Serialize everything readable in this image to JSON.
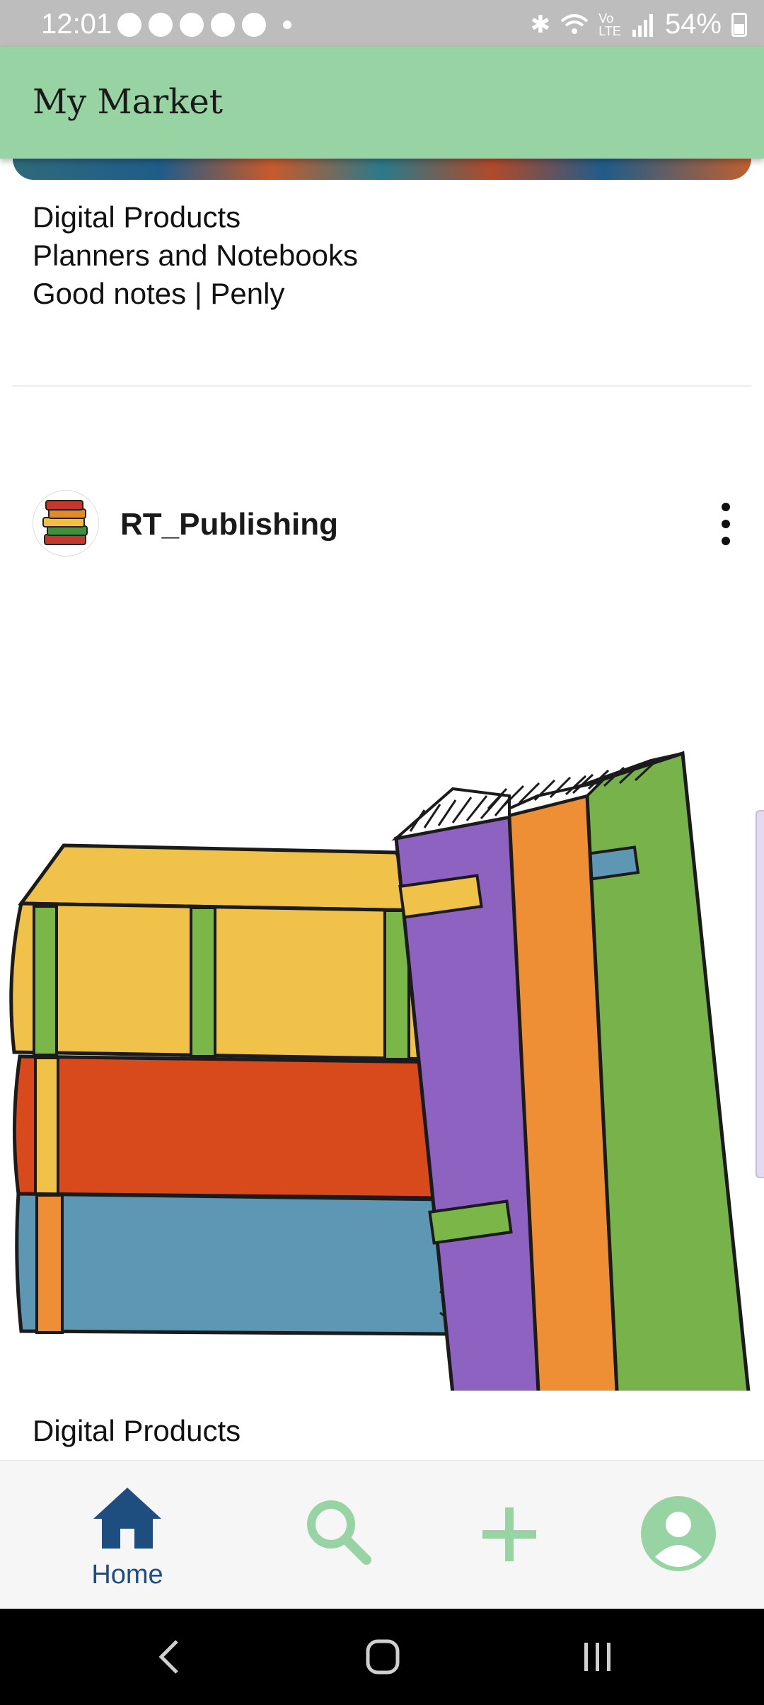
{
  "status_bar": {
    "time": "12:01",
    "battery": "54%",
    "icons": [
      "gear-icon",
      "pinterest-icon",
      "missed-call-icon",
      "snapchat-icon",
      "skype-icon",
      "dot-icon",
      "bluetooth-icon",
      "wifi-icon",
      "volte-icon",
      "signal-icon",
      "battery-icon"
    ]
  },
  "app_bar": {
    "title": "My Market",
    "background": "#98d4a3"
  },
  "feed": {
    "previous_post": {
      "caption": [
        "Digital Products",
        "Planners and Notebooks",
        "Good notes | Penly"
      ]
    },
    "post": {
      "author": "RT_Publishing",
      "avatar_icon": "book-stack-icon",
      "image_icon": "books-illustration",
      "caption": [
        "Digital Products"
      ]
    }
  },
  "bottom_nav": {
    "items": [
      {
        "label": "Home",
        "icon": "home-icon",
        "active": true
      },
      {
        "label": "",
        "icon": "search-icon",
        "active": false
      },
      {
        "label": "",
        "icon": "add-icon",
        "active": false
      },
      {
        "label": "",
        "icon": "profile-icon",
        "active": false
      }
    ],
    "active_color": "#1e4d80",
    "inactive_color": "#98d4a3"
  },
  "system_nav": {
    "buttons": [
      "back-icon",
      "home-circle-icon",
      "recents-icon"
    ]
  }
}
